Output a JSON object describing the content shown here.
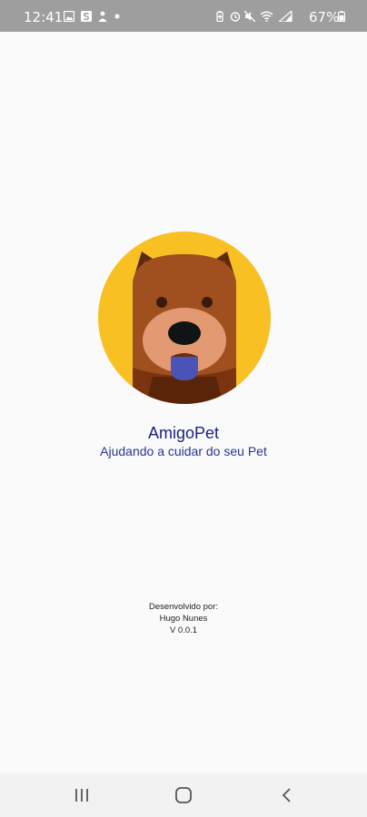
{
  "status_bar": {
    "time": "12:41",
    "battery": "67%",
    "left_icons": [
      "gallery-icon",
      "s-app-icon",
      "person-icon",
      "dot-icon"
    ],
    "right_icons": [
      "battery-saver-icon",
      "alarm-icon",
      "mute-icon",
      "wifi-icon",
      "signal-icon",
      "battery-icon"
    ]
  },
  "app": {
    "name": "AmigoPet",
    "tagline": "Ajudando a cuidar do seu Pet",
    "logo_colors": {
      "ring": "#f9c023",
      "fur": "#a0501f",
      "muzzle": "#e39a72",
      "tongue": "#4a54b8"
    }
  },
  "credits": {
    "label": "Desenvolvido por:",
    "author": "Hugo Nunes",
    "version": "V 0.0.1"
  },
  "nav_bar": {
    "buttons": [
      "recent-apps-icon",
      "home-icon",
      "back-icon"
    ]
  }
}
